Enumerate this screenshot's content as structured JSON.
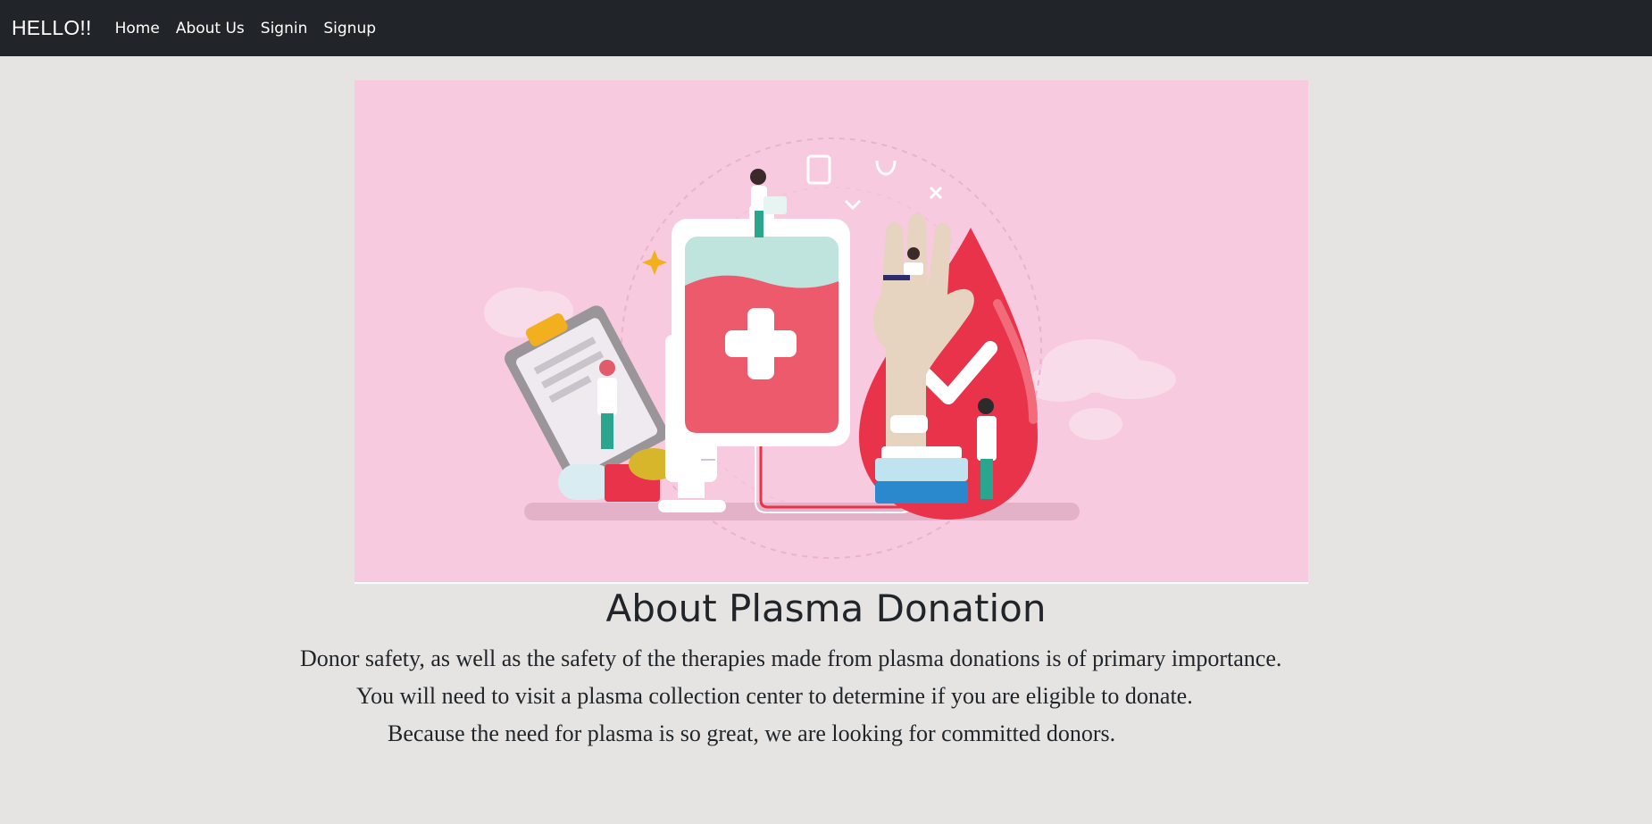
{
  "navbar": {
    "brand": "HELLO!!",
    "links": [
      "Home",
      "About Us",
      "Signin",
      "Signup"
    ]
  },
  "hero": {
    "image": "plasma-donation-illustration",
    "colors": {
      "background": "#f7cae0",
      "blood_red": "#e8334a",
      "bag_mint": "#bfe3dd",
      "hand": "#e6d4c0"
    }
  },
  "content": {
    "title": "About Plasma Donation",
    "paragraphs": [
      "Donor safety, as well as the safety of the therapies made from plasma donations is of primary importance.",
      "You will need to visit a plasma collection center to determine if you are eligible to donate.",
      "Because the need for plasma is so great, we are looking for committed donors."
    ]
  },
  "colors": {
    "navbar": "#212529",
    "page_background": "#e5e4e3",
    "text": "#212529"
  }
}
